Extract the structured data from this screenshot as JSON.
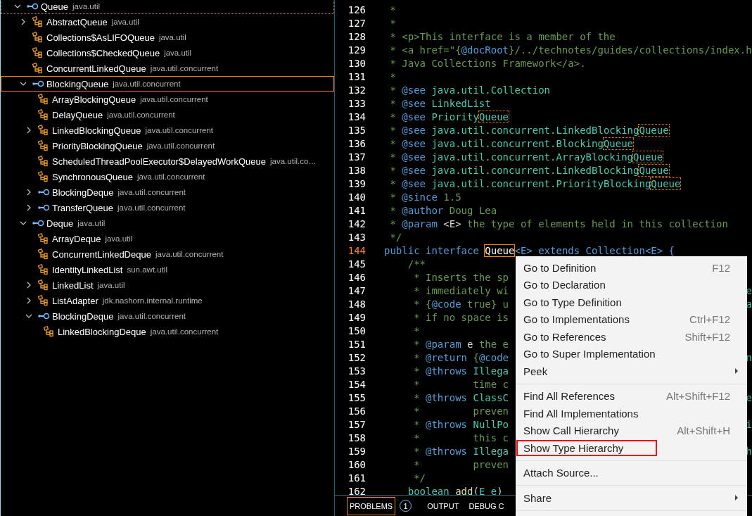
{
  "type_hierarchy": {
    "items": [
      {
        "name": "Queue",
        "package": "java.util",
        "kind": "interface",
        "expanded": true,
        "selected": false,
        "focused": true,
        "children": [
          {
            "name": "AbstractQueue",
            "package": "java.util",
            "kind": "class",
            "expanded": false,
            "selected": false,
            "focused": false
          },
          {
            "name": "Collections$AsLIFOQueue",
            "package": "java.util",
            "kind": "class",
            "selected": false,
            "focused": false
          },
          {
            "name": "Collections$CheckedQueue",
            "package": "java.util",
            "kind": "class",
            "selected": false,
            "focused": false
          },
          {
            "name": "ConcurrentLinkedQueue",
            "package": "java.util.concurrent",
            "kind": "class",
            "selected": false,
            "focused": false
          },
          {
            "name": "BlockingQueue",
            "package": "java.util.concurrent",
            "kind": "interface",
            "expanded": true,
            "selected": true,
            "focused": false,
            "children": [
              {
                "name": "ArrayBlockingQueue",
                "package": "java.util.concurrent",
                "kind": "class",
                "selected": false,
                "focused": false
              },
              {
                "name": "DelayQueue",
                "package": "java.util.concurrent",
                "kind": "class",
                "selected": false,
                "focused": false
              },
              {
                "name": "LinkedBlockingQueue",
                "package": "java.util.concurrent",
                "kind": "class",
                "expanded": false,
                "selected": false,
                "focused": false
              },
              {
                "name": "PriorityBlockingQueue",
                "package": "java.util.concurrent",
                "kind": "class",
                "selected": false,
                "focused": false
              },
              {
                "name": "ScheduledThreadPoolExecutor$DelayedWorkQueue",
                "package": "java.util.co…",
                "kind": "class",
                "selected": false,
                "focused": false
              },
              {
                "name": "SynchronousQueue",
                "package": "java.util.concurrent",
                "kind": "class",
                "selected": false,
                "focused": false
              },
              {
                "name": "BlockingDeque",
                "package": "java.util.concurrent",
                "kind": "interface",
                "expanded": false,
                "selected": false,
                "focused": false
              },
              {
                "name": "TransferQueue",
                "package": "java.util.concurrent",
                "kind": "interface",
                "expanded": false,
                "selected": false,
                "focused": false
              }
            ]
          },
          {
            "name": "Deque",
            "package": "java.util",
            "kind": "interface",
            "expanded": true,
            "selected": false,
            "focused": false,
            "children": [
              {
                "name": "ArrayDeque",
                "package": "java.util",
                "kind": "class",
                "selected": false,
                "focused": false
              },
              {
                "name": "ConcurrentLinkedDeque",
                "package": "java.util.concurrent",
                "kind": "class",
                "selected": false,
                "focused": false
              },
              {
                "name": "IdentityLinkedList",
                "package": "sun.awt.util",
                "kind": "class",
                "selected": false,
                "focused": false
              },
              {
                "name": "LinkedList",
                "package": "java.util",
                "kind": "class",
                "expanded": false,
                "selected": false,
                "focused": false
              },
              {
                "name": "ListAdapter",
                "package": "jdk.nashorn.internal.runtime",
                "kind": "class",
                "expanded": false,
                "selected": false,
                "focused": false
              },
              {
                "name": "BlockingDeque",
                "package": "java.util.concurrent",
                "kind": "interface",
                "expanded": true,
                "selected": false,
                "focused": false,
                "children": [
                  {
                    "name": "LinkedBlockingDeque",
                    "package": "java.util.concurrent",
                    "kind": "class",
                    "selected": false,
                    "focused": false
                  }
                ]
              }
            ]
          }
        ]
      }
    ]
  },
  "editor": {
    "lines": [
      {
        "number": "126",
        "current": false,
        "code": [
          {
            "text": " *",
            "kind": "comment"
          }
        ]
      },
      {
        "number": "127",
        "current": false,
        "code": [
          {
            "text": " *",
            "kind": "comment"
          }
        ]
      },
      {
        "number": "128",
        "current": false,
        "code": [
          {
            "text": " * <p>This interface is a member of the",
            "kind": "comment"
          }
        ]
      },
      {
        "number": "129",
        "current": false,
        "code": [
          {
            "text": " * <a href=\"{",
            "kind": "comment"
          },
          {
            "text": "@docRoot",
            "kind": "tag"
          },
          {
            "text": "}/../technotes/guides/collections/index.h",
            "kind": "comment"
          }
        ]
      },
      {
        "number": "130",
        "current": false,
        "code": [
          {
            "text": " * Java Collections Framework</a>.",
            "kind": "comment"
          }
        ]
      },
      {
        "number": "131",
        "current": false,
        "code": [
          {
            "text": " *",
            "kind": "comment"
          }
        ]
      },
      {
        "number": "132",
        "current": false,
        "code": [
          {
            "text": " * ",
            "kind": "comment"
          },
          {
            "text": "@see",
            "kind": "tag"
          },
          {
            "text": " java.util.Collection",
            "kind": "ref"
          }
        ]
      },
      {
        "number": "133",
        "current": false,
        "code": [
          {
            "text": " * ",
            "kind": "comment"
          },
          {
            "text": "@see",
            "kind": "tag"
          },
          {
            "text": " LinkedList",
            "kind": "ref"
          }
        ]
      },
      {
        "number": "134",
        "current": false,
        "code": [
          {
            "text": " * ",
            "kind": "comment"
          },
          {
            "text": "@see",
            "kind": "tag"
          },
          {
            "text": " Priority",
            "kind": "ref"
          },
          {
            "text": "Queue",
            "kind": "match"
          }
        ]
      },
      {
        "number": "135",
        "current": false,
        "code": [
          {
            "text": " * ",
            "kind": "comment"
          },
          {
            "text": "@see",
            "kind": "tag"
          },
          {
            "text": " java.util.concurrent.LinkedBlocking",
            "kind": "ref"
          },
          {
            "text": "Queue",
            "kind": "match"
          }
        ]
      },
      {
        "number": "136",
        "current": false,
        "code": [
          {
            "text": " * ",
            "kind": "comment"
          },
          {
            "text": "@see",
            "kind": "tag"
          },
          {
            "text": " java.util.concurrent.Blocking",
            "kind": "ref"
          },
          {
            "text": "Queue",
            "kind": "match"
          }
        ]
      },
      {
        "number": "137",
        "current": false,
        "code": [
          {
            "text": " * ",
            "kind": "comment"
          },
          {
            "text": "@see",
            "kind": "tag"
          },
          {
            "text": " java.util.concurrent.ArrayBlocking",
            "kind": "ref"
          },
          {
            "text": "Queue",
            "kind": "match"
          }
        ]
      },
      {
        "number": "138",
        "current": false,
        "code": [
          {
            "text": " * ",
            "kind": "comment"
          },
          {
            "text": "@see",
            "kind": "tag"
          },
          {
            "text": " java.util.concurrent.LinkedBlocking",
            "kind": "ref"
          },
          {
            "text": "Queue",
            "kind": "match"
          }
        ]
      },
      {
        "number": "139",
        "current": false,
        "code": [
          {
            "text": " * ",
            "kind": "comment"
          },
          {
            "text": "@see",
            "kind": "tag"
          },
          {
            "text": " java.util.concurrent.PriorityBlocking",
            "kind": "ref"
          },
          {
            "text": "Queue",
            "kind": "match"
          }
        ]
      },
      {
        "number": "140",
        "current": false,
        "code": [
          {
            "text": " * ",
            "kind": "comment"
          },
          {
            "text": "@since",
            "kind": "tag"
          },
          {
            "text": " 1.5",
            "kind": "comment"
          }
        ]
      },
      {
        "number": "141",
        "current": false,
        "code": [
          {
            "text": " * ",
            "kind": "comment"
          },
          {
            "text": "@author",
            "kind": "tag"
          },
          {
            "text": " Doug Lea",
            "kind": "comment"
          }
        ]
      },
      {
        "number": "142",
        "current": false,
        "code": [
          {
            "text": " * ",
            "kind": "comment"
          },
          {
            "text": "@param",
            "kind": "tag"
          },
          {
            "text": " <E>",
            "kind": "plain"
          },
          {
            "text": " the type of elements held in this collection",
            "kind": "comment"
          }
        ]
      },
      {
        "number": "143",
        "current": false,
        "code": [
          {
            "text": " */",
            "kind": "comment"
          }
        ]
      },
      {
        "number": "144",
        "current": true,
        "code": [
          {
            "text": "public interface ",
            "kind": "keyword"
          },
          {
            "text": "Queue",
            "kind": "cursor"
          },
          {
            "text": "<E> extends Collection<E> {",
            "kind": "keyword"
          }
        ]
      },
      {
        "number": "145",
        "current": false,
        "code": [
          {
            "text": "    /**",
            "kind": "comment"
          }
        ]
      },
      {
        "number": "146",
        "current": false,
        "code": [
          {
            "text": "     * Inserts the sp",
            "kind": "comment"
          }
        ]
      },
      {
        "number": "147",
        "current": false,
        "code": [
          {
            "text": "     * immediately wi",
            "kind": "comment"
          }
        ],
        "right": "e"
      },
      {
        "number": "148",
        "current": false,
        "code": [
          {
            "text": "     * {",
            "kind": "comment"
          },
          {
            "text": "@code",
            "kind": "tag"
          },
          {
            "text": " true} u",
            "kind": "comment"
          }
        ],
        "right": "a"
      },
      {
        "number": "149",
        "current": false,
        "code": [
          {
            "text": "     * if no space is",
            "kind": "comment"
          }
        ]
      },
      {
        "number": "150",
        "current": false,
        "code": [
          {
            "text": "     *",
            "kind": "comment"
          }
        ]
      },
      {
        "number": "151",
        "current": false,
        "code": [
          {
            "text": "     * ",
            "kind": "comment"
          },
          {
            "text": "@param",
            "kind": "tag"
          },
          {
            "text": " e",
            "kind": "plain"
          },
          {
            "text": " the e",
            "kind": "comment"
          }
        ]
      },
      {
        "number": "152",
        "current": false,
        "code": [
          {
            "text": "     * ",
            "kind": "comment"
          },
          {
            "text": "@return",
            "kind": "tag"
          },
          {
            "text": " {",
            "kind": "comment"
          },
          {
            "text": "@code",
            "kind": "tag"
          }
        ],
        "right": "n"
      },
      {
        "number": "153",
        "current": false,
        "code": [
          {
            "text": "     * ",
            "kind": "comment"
          },
          {
            "text": "@throws",
            "kind": "tag"
          },
          {
            "text": " Illega",
            "kind": "ref"
          }
        ]
      },
      {
        "number": "154",
        "current": false,
        "code": [
          {
            "text": "     *         time c",
            "kind": "comment"
          }
        ]
      },
      {
        "number": "155",
        "current": false,
        "code": [
          {
            "text": "     * ",
            "kind": "comment"
          },
          {
            "text": "@throws",
            "kind": "tag"
          },
          {
            "text": " ClassC",
            "kind": "ref"
          }
        ],
        "right": "e"
      },
      {
        "number": "156",
        "current": false,
        "code": [
          {
            "text": "     *         preven",
            "kind": "comment"
          }
        ]
      },
      {
        "number": "157",
        "current": false,
        "code": [
          {
            "text": "     * ",
            "kind": "comment"
          },
          {
            "text": "@throws",
            "kind": "tag"
          },
          {
            "text": " NullPo",
            "kind": "ref"
          }
        ],
        "right": "i"
      },
      {
        "number": "158",
        "current": false,
        "code": [
          {
            "text": "     *         this c",
            "kind": "comment"
          }
        ]
      },
      {
        "number": "159",
        "current": false,
        "code": [
          {
            "text": "     * ",
            "kind": "comment"
          },
          {
            "text": "@throws",
            "kind": "tag"
          },
          {
            "text": " Illega",
            "kind": "ref"
          }
        ],
        "right": "h"
      },
      {
        "number": "160",
        "current": false,
        "code": [
          {
            "text": "     *         preven",
            "kind": "comment"
          }
        ]
      },
      {
        "number": "161",
        "current": false,
        "code": [
          {
            "text": "     */",
            "kind": "comment"
          }
        ]
      },
      {
        "number": "162",
        "current": false,
        "code": [
          {
            "text": "    boolean ",
            "kind": "type"
          },
          {
            "text": "add",
            "kind": "func"
          },
          {
            "text": "(",
            "kind": "plain"
          },
          {
            "text": "E e",
            "kind": "ref"
          },
          {
            "text": ")",
            "kind": "plain"
          }
        ]
      }
    ]
  },
  "panel_tabs": [
    {
      "label": "PROBLEMS",
      "selected": true,
      "badge": "1"
    },
    {
      "label": "OUTPUT",
      "selected": false
    },
    {
      "label": "DEBUG C",
      "selected": false
    }
  ],
  "context_menu": {
    "groups": [
      [
        {
          "label": "Go to Definition",
          "shortcut": "F12",
          "highlighted": false
        },
        {
          "label": "Go to Declaration",
          "highlighted": false
        },
        {
          "label": "Go to Type Definition",
          "highlighted": false
        },
        {
          "label": "Go to Implementations",
          "shortcut": "Ctrl+F12",
          "highlighted": false
        },
        {
          "label": "Go to References",
          "shortcut": "Shift+F12",
          "highlighted": false
        },
        {
          "label": "Go to Super Implementation",
          "highlighted": false
        },
        {
          "label": "Peek",
          "submenu": true,
          "highlighted": false
        }
      ],
      [
        {
          "label": "Find All References",
          "shortcut": "Alt+Shift+F12",
          "highlighted": false
        },
        {
          "label": "Find All Implementations",
          "highlighted": false
        },
        {
          "label": "Show Call Hierarchy",
          "shortcut": "Alt+Shift+H",
          "highlighted": false
        },
        {
          "label": "Show Type Hierarchy",
          "highlighted": true
        }
      ],
      [
        {
          "label": "Attach Source...",
          "highlighted": false
        }
      ],
      [
        {
          "label": "Share",
          "submenu": true,
          "highlighted": false
        }
      ]
    ]
  }
}
